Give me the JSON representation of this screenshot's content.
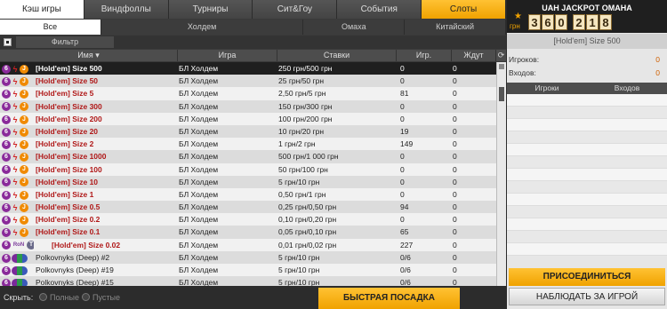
{
  "tabs": [
    "Кэш игры",
    "Виндфоллы",
    "Турниры",
    "Сит&Гоу",
    "События",
    "Слоты"
  ],
  "subtabs": [
    "Все",
    "Холдем",
    "Омаха",
    "Китайский"
  ],
  "filter_label": "Фильтр",
  "columns": [
    "Имя",
    "Игра",
    "Ставки",
    "Игр.",
    "Ждут"
  ],
  "rows": [
    {
      "name": "[Hold'em] Size 500",
      "game": "БЛ Холдем",
      "stakes": "250 грн/500 грн",
      "players": "0",
      "waiting": "0",
      "icons": "std",
      "selected": true
    },
    {
      "name": "[Hold'em] Size 50",
      "game": "БЛ Холдем",
      "stakes": "25 грн/50 грн",
      "players": "0",
      "waiting": "0",
      "icons": "std"
    },
    {
      "name": "[Hold'em] Size 5",
      "game": "БЛ Холдем",
      "stakes": "2,50 грн/5 грн",
      "players": "81",
      "waiting": "0",
      "icons": "std"
    },
    {
      "name": "[Hold'em] Size 300",
      "game": "БЛ Холдем",
      "stakes": "150 грн/300 грн",
      "players": "0",
      "waiting": "0",
      "icons": "std"
    },
    {
      "name": "[Hold'em] Size 200",
      "game": "БЛ Холдем",
      "stakes": "100 грн/200 грн",
      "players": "0",
      "waiting": "0",
      "icons": "std"
    },
    {
      "name": "[Hold'em] Size 20",
      "game": "БЛ Холдем",
      "stakes": "10 грн/20 грн",
      "players": "19",
      "waiting": "0",
      "icons": "std"
    },
    {
      "name": "[Hold'em] Size 2",
      "game": "БЛ Холдем",
      "stakes": "1 грн/2 грн",
      "players": "149",
      "waiting": "0",
      "icons": "std"
    },
    {
      "name": "[Hold'em] Size 1000",
      "game": "БЛ Холдем",
      "stakes": "500 грн/1 000 грн",
      "players": "0",
      "waiting": "0",
      "icons": "std"
    },
    {
      "name": "[Hold'em] Size 100",
      "game": "БЛ Холдем",
      "stakes": "50 грн/100 грн",
      "players": "0",
      "waiting": "0",
      "icons": "std"
    },
    {
      "name": "[Hold'em] Size 10",
      "game": "БЛ Холдем",
      "stakes": "5 грн/10 грн",
      "players": "0",
      "waiting": "0",
      "icons": "std"
    },
    {
      "name": "[Hold'em] Size 1",
      "game": "БЛ Холдем",
      "stakes": "0,50 грн/1 грн",
      "players": "0",
      "waiting": "0",
      "icons": "std"
    },
    {
      "name": "[Hold'em] Size 0.5",
      "game": "БЛ Холдем",
      "stakes": "0,25 грн/0,50 грн",
      "players": "94",
      "waiting": "0",
      "icons": "std"
    },
    {
      "name": "[Hold'em] Size 0.2",
      "game": "БЛ Холдем",
      "stakes": "0,10 грн/0,20 грн",
      "players": "0",
      "waiting": "0",
      "icons": "std"
    },
    {
      "name": "[Hold'em] Size 0.1",
      "game": "БЛ Холдем",
      "stakes": "0,05 грн/0,10 грн",
      "players": "65",
      "waiting": "0",
      "icons": "std"
    },
    {
      "name": "[Hold'em] Size 0.02",
      "game": "БЛ Холдем",
      "stakes": "0,01 грн/0,02 грн",
      "players": "227",
      "waiting": "0",
      "icons": "ron"
    },
    {
      "name": "Polkovnyks (Deep) #2",
      "game": "БЛ Холдем",
      "stakes": "5 грн/10 грн",
      "players": "0/6",
      "waiting": "0",
      "icons": "deep"
    },
    {
      "name": "Polkovnyks (Deep) #19",
      "game": "БЛ Холдем",
      "stakes": "5 грн/10 грн",
      "players": "0/6",
      "waiting": "0",
      "icons": "deep"
    },
    {
      "name": "Polkovnyks (Deep) #15",
      "game": "БЛ Холдем",
      "stakes": "5 грн/10 грн",
      "players": "0/6",
      "waiting": "0",
      "icons": "deep"
    }
  ],
  "bottom": {
    "hide_label": "Скрыть:",
    "full_label": "Полные",
    "empty_label": "Пустые",
    "quick_seat": "БЫСТРАЯ ПОСАДКА"
  },
  "jackpot": {
    "title": "UAH JACKPOT ОМАНА",
    "currency": "грн",
    "digits": [
      "3",
      "6",
      "0",
      "2",
      "1",
      "8"
    ]
  },
  "side": {
    "table_name": "[Hold'em] Size 500",
    "players_label": "Игроков:",
    "players_value": "0",
    "entries_label": "Входов:",
    "entries_value": "0",
    "col_players": "Игроки",
    "col_entries": "Входов",
    "join": "ПРИСОЕДИНИТЬСЯ",
    "watch": "НАБЛЮДАТЬ ЗА ИГРОЙ"
  },
  "icon_names": {
    "six": "six-icon",
    "bolt": "lightning-icon",
    "jack": "jackpot-icon",
    "ron": "ron-icon",
    "deep": "deep-icon"
  }
}
